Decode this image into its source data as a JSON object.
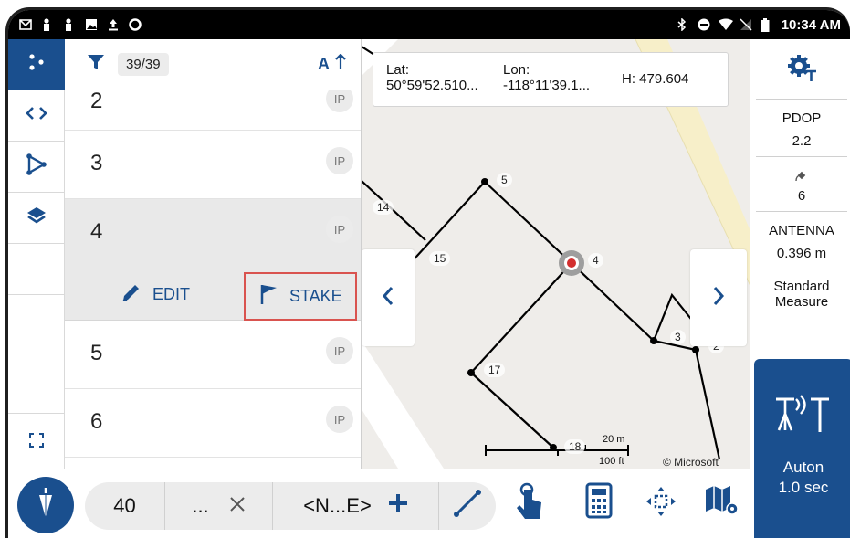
{
  "status_bar": {
    "time": "10:34 AM"
  },
  "point_list": {
    "filter_count": "39/39",
    "sort_label": "A",
    "points": [
      {
        "name": "2",
        "code": "IP"
      },
      {
        "name": "3",
        "code": "IP"
      },
      {
        "name": "4",
        "code": "IP"
      },
      {
        "name": "5",
        "code": "IP"
      },
      {
        "name": "6",
        "code": "IP"
      }
    ],
    "actions": {
      "edit": "EDIT",
      "stake": "STAKE"
    }
  },
  "map": {
    "lat_label": "Lat:",
    "lat_value": "50°59'52.510...",
    "lon_label": "Lon:",
    "lon_value": "-118°11'39.1...",
    "height": "H: 479.604",
    "point_labels": [
      "5",
      "14",
      "15",
      "4",
      "3",
      "2",
      "17",
      "18"
    ],
    "scale_metric": "20 m",
    "scale_imperial": "100 ft",
    "copyright": "© Microsoft",
    "colors": {
      "road": "#f6edc2",
      "background": "#efedea",
      "line": "#000000",
      "target": "#d32f2f"
    }
  },
  "status_panel": {
    "pdop_label": "PDOP",
    "pdop_value": "2.2",
    "satellites": "6",
    "antenna_label": "ANTENNA",
    "antenna_value": "0.396 m",
    "measure_mode_line1": "Standard",
    "measure_mode_line2": "Measure",
    "auto_line1": "Auton",
    "auto_line2": "1.0 sec"
  },
  "toolbar": {
    "point_number": "40",
    "code_value": "...",
    "direction": "<N...E>"
  },
  "theme": {
    "accent": "#1a4f8e",
    "highlight_border": "#d9534f"
  }
}
